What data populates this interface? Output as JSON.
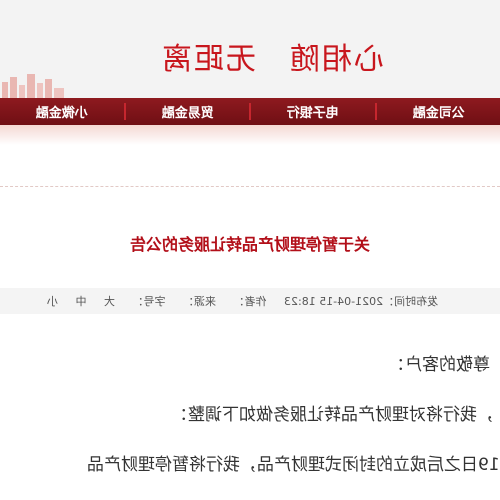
{
  "banner": {
    "slogan": "心相随　无距离"
  },
  "nav": {
    "items": [
      "公司金融",
      "电子银行",
      "贸易金融",
      "小微金融"
    ]
  },
  "article": {
    "title": "关于暂停理财产品转让服务的公告",
    "meta": {
      "publish_time": "发布时间：2021-04-15 18:23",
      "author": "作者：",
      "source": "来源：",
      "font_size_label": "字号：",
      "size_large": "大",
      "size_medium": "中",
      "size_small": "小"
    },
    "paragraphs": [
      "尊敬的客户：",
      "，我行将对理财产品转让服务做如下调整：",
      "19日之后成立的封闭式理财产品，我行将暂停理财产品"
    ]
  },
  "colors": {
    "brand": "#8e1a1f",
    "title": "#b20f19",
    "slogan": "#c8161d"
  }
}
